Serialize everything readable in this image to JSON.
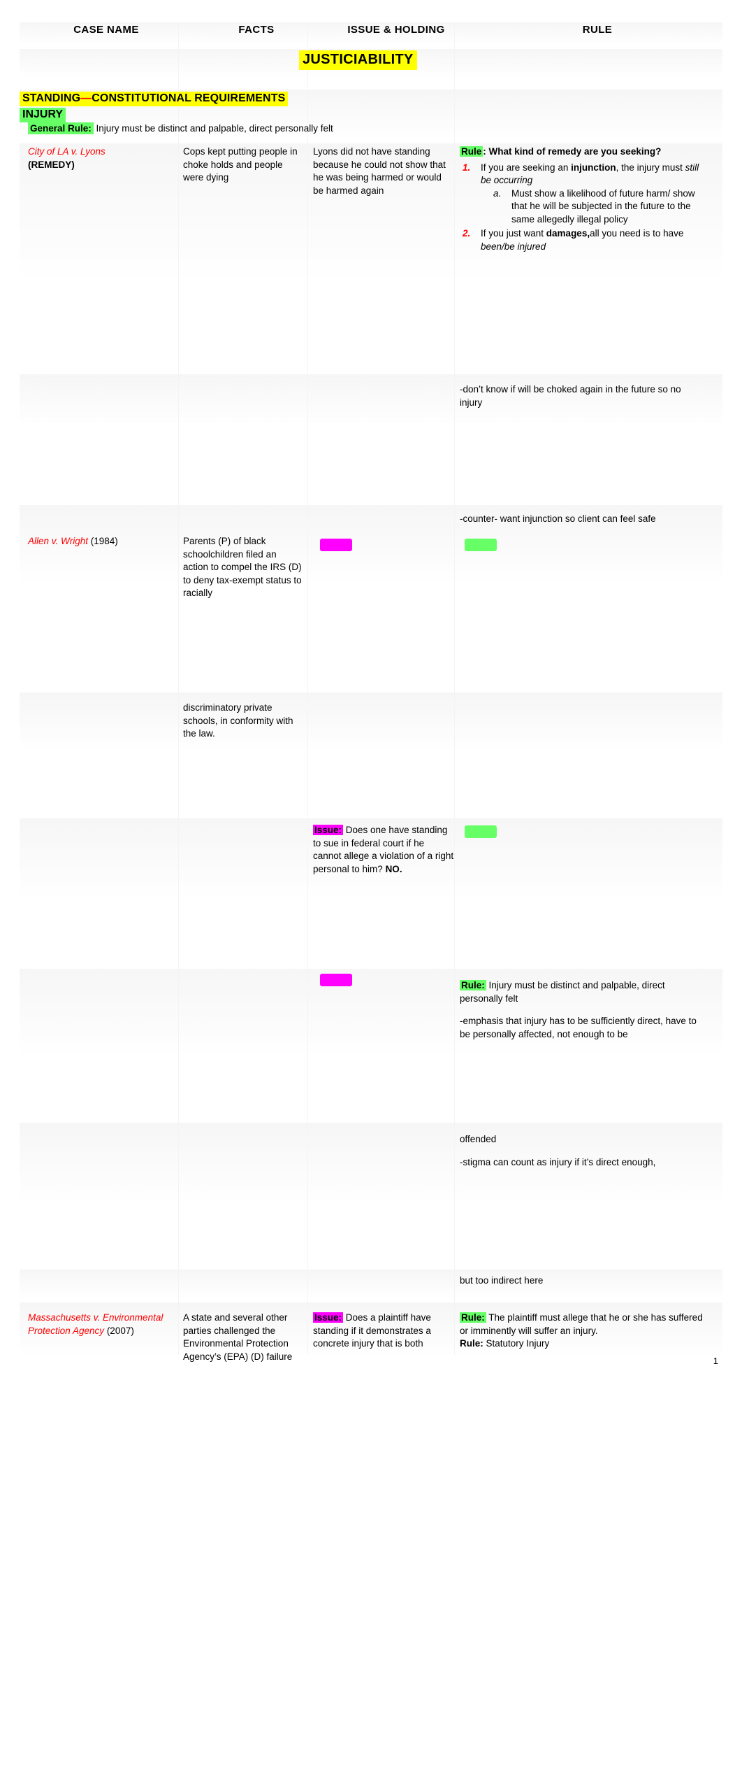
{
  "document": {
    "page_number": "1",
    "title": "JUSTICIABILITY",
    "columns": [
      {
        "label": "CASE NAME"
      },
      {
        "label": "FACTS"
      },
      {
        "label": "ISSUE & HOLDING"
      },
      {
        "label": "RULE"
      }
    ],
    "section": {
      "heading_line1_part1": "STANDING",
      "heading_line1_dash": "—",
      "heading_line1_part2": "CONSTITUTIONAL REQUIREMENTS",
      "heading_line2": "INJURY",
      "general_rule_label": "General Rule:",
      "general_rule_text": " Injury must be distinct and palpable, direct personally felt"
    },
    "rows": [
      {
        "case_name_italic": "City of LA v. Lyons",
        "case_name_sub": "(REMEDY)",
        "facts": "Cops kept putting people in choke holds and people were dying",
        "issue": "Lyons did not have standing because he could not show that he was being harmed or would be harmed again",
        "rule_label": "Rule",
        "rule_label_after": ": What kind of remedy are you seeking?",
        "rule_item1_a": "If you are seeking an ",
        "rule_item1_b": "injunction",
        "rule_item1_c": ", the injury must ",
        "rule_item1_d": "still be occurring",
        "rule_item1_sub_a": "Must show a likelihood of future harm/ show that he will be subjected in the future to the same allegedly illegal policy",
        "rule_item2_a": "If you just want ",
        "rule_item2_b": "damages,",
        "rule_item2_c": "all you need is to have ",
        "rule_item2_d": "been/be injured",
        "note_choked": "-don’t know if will be choked again in the future so no injury",
        "note_counter": "-counter- want injunction so client can feel safe"
      },
      {
        "case_name_italic": "Allen v. Wright",
        "case_year": " (1984)",
        "facts_part1": "Parents (P) of black schoolchildren filed an action to compel the IRS (D) to deny tax-exempt status to racially",
        "facts_part2": "discriminatory private schools, in conformity with the law.",
        "issue_label": "Issue:",
        "issue_text": "  Does one have standing to sue in federal court if he cannot allege a violation of a right personal to him? ",
        "issue_holding": "NO.",
        "rule_label": "Rule:",
        "rule_text": " Injury must be distinct and palpable, direct personally felt",
        "note_emphasis": "-emphasis that injury has to be sufficiently direct, have to be personally affected, not enough to be",
        "note_offended": "offended",
        "note_stigma": "-stigma can count as injury if it’s direct enough,",
        "note_indirect": "but too indirect here"
      },
      {
        "case_name_italic": "Massachusetts v. Environmental Protection Agency",
        "case_year": " (2007)",
        "facts": "A state and several other parties challenged the Environmental Protection Agency’s (EPA) (D) failure",
        "issue_label": "Issue:",
        "issue_text": " Does a plaintiff have standing if it demonstrates a concrete injury that is both",
        "rule_label": "Rule:",
        "rule_text": " The plaintiff must allege that he or she has suffered or imminently will suffer an injury.",
        "rule_label2": "Rule:",
        "rule_text2": " Statutory Injury"
      }
    ],
    "colors": {
      "highlight_yellow": "#ffff00",
      "highlight_green": "#66ff66",
      "highlight_magenta": "#ff00ff",
      "case_name_red": "#ff0000"
    }
  }
}
